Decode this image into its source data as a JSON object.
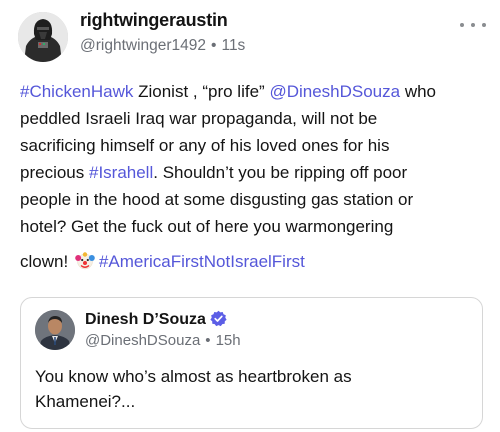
{
  "post": {
    "author": {
      "username": "rightwingeraustin",
      "handle": "@rightwinger1492",
      "time": "11s"
    },
    "separator": "•",
    "body": {
      "line1": {
        "tag": "#ChickenHawk",
        "text": " Zionist , “pro life” ",
        "mention": "@DineshDSouza",
        "tail": " who"
      },
      "line2": "peddled Israeli Iraq war propaganda, will not be",
      "line3": "sacrificing himself or any of his loved ones for his",
      "line4": {
        "pre": "precious ",
        "tag": "#Israhell",
        "text": ". Shouldn’t you be ripping off poor"
      },
      "line5": "people in the hood at some disgusting gas station or",
      "line6": "hotel? Get the fuck out of here you warmongering",
      "line7": {
        "text": "clown! ",
        "icon": "clown-face-icon",
        "tag": "#AmericaFirstNotIsraelFirst"
      }
    },
    "more_icon": "more-horizontal-icon",
    "colors": {
      "hashtag": "#5557d9",
      "muted": "#6b6f76",
      "verified": "#5c5ee6"
    }
  },
  "quote": {
    "author": {
      "name": "Dinesh D’Souza",
      "handle": "@DineshDSouza",
      "time": "15h",
      "badge": "verified-badge-icon"
    },
    "body": {
      "line1": "You know who’s almost as heartbroken as",
      "line2": "Khamenei?..."
    }
  }
}
